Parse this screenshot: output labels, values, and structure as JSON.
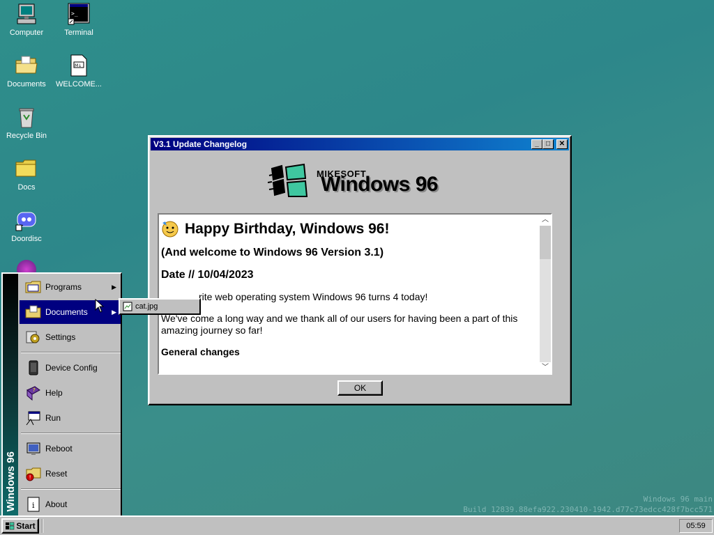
{
  "desktop": {
    "icons": [
      {
        "label": "Computer"
      },
      {
        "label": "Terminal"
      },
      {
        "label": "Documents"
      },
      {
        "label": "WELCOME..."
      },
      {
        "label": "Recycle Bin"
      },
      {
        "label": "Docs"
      },
      {
        "label": "Doordisc"
      }
    ],
    "watermark_line1": "Windows 96 main",
    "watermark_line2": "Build 12839.88efa922.230410-1942.d77c73edcc428f7bcc571"
  },
  "changelog_window": {
    "title": "V3.1 Update Changelog",
    "brand_small": "MIKESOFT",
    "brand_large": "Windows 96",
    "heading": "Happy Birthday, Windows 96!",
    "subheading": "(And welcome to Windows 96 Version 3.1)",
    "date_line": "Date // 10/04/2023",
    "para1": "rite web operating system Windows 96 turns 4 today!",
    "para2": "We've come a long way and we thank all of our users for having been a part of this amazing journey so far!",
    "section_title": "General changes",
    "ok_label": "OK",
    "btn_min": "_",
    "btn_max": "□",
    "btn_close": "✕"
  },
  "start_menu": {
    "banner": "Windows 96",
    "items": [
      {
        "label": "Programs",
        "icon": "programs-folder-icon",
        "submenu": true
      },
      {
        "label": "Documents",
        "icon": "documents-folder-icon",
        "submenu": true
      },
      {
        "label": "Settings",
        "icon": "settings-icon",
        "submenu": false
      },
      {
        "label": "Device Config",
        "icon": "device-config-icon",
        "submenu": false
      },
      {
        "label": "Help",
        "icon": "help-book-icon",
        "submenu": false
      },
      {
        "label": "Run",
        "icon": "run-icon",
        "submenu": false
      },
      {
        "label": "Reboot",
        "icon": "reboot-icon",
        "submenu": false
      },
      {
        "label": "Reset",
        "icon": "reset-icon",
        "submenu": false
      },
      {
        "label": "About",
        "icon": "about-icon",
        "submenu": false
      }
    ],
    "submenu_documents": [
      {
        "label": "cat.jpg"
      }
    ],
    "submenu_arrow": "▶"
  },
  "taskbar": {
    "start_label": "Start",
    "clock": "05:59"
  },
  "colors": {
    "desktop": "#2f8f8b",
    "titlebar_start": "#000080",
    "titlebar_end": "#1084d0",
    "highlight": "#000080"
  }
}
